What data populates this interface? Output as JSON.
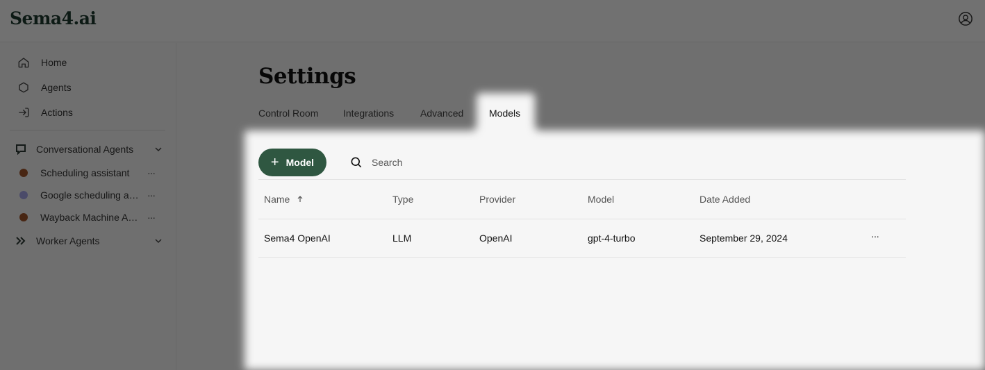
{
  "app": {
    "logo": "Sema4.ai"
  },
  "sidebar": {
    "nav": [
      {
        "label": "Home",
        "icon": "home-icon"
      },
      {
        "label": "Agents",
        "icon": "hexagon-icon"
      },
      {
        "label": "Actions",
        "icon": "arrow-in-icon"
      }
    ],
    "conversational": {
      "label": "Conversational Agents",
      "agents": [
        {
          "label": "Scheduling assistant",
          "color": "#a0552a"
        },
        {
          "label": "Google scheduling assistant",
          "color": "#a7a6e8"
        },
        {
          "label": "Wayback Machine Agent",
          "color": "#a0552a"
        }
      ]
    },
    "worker": {
      "label": "Worker Agents"
    }
  },
  "page": {
    "title": "Settings",
    "tabs": [
      "Control Room",
      "Integrations",
      "Advanced",
      "Models"
    ],
    "active_tab": "Models",
    "add_button": "Model",
    "search_placeholder": "Search"
  },
  "table": {
    "headers": [
      "Name",
      "Type",
      "Provider",
      "Model",
      "Date Added"
    ],
    "rows": [
      {
        "name": "Sema4 OpenAI",
        "type": "LLM",
        "provider": "OpenAI",
        "model": "gpt-4-turbo",
        "date": "September 29, 2024",
        "more": "···"
      }
    ]
  },
  "colors": {
    "accent": "#2f5741",
    "overlay": "rgba(0,0,0,0.55)"
  }
}
